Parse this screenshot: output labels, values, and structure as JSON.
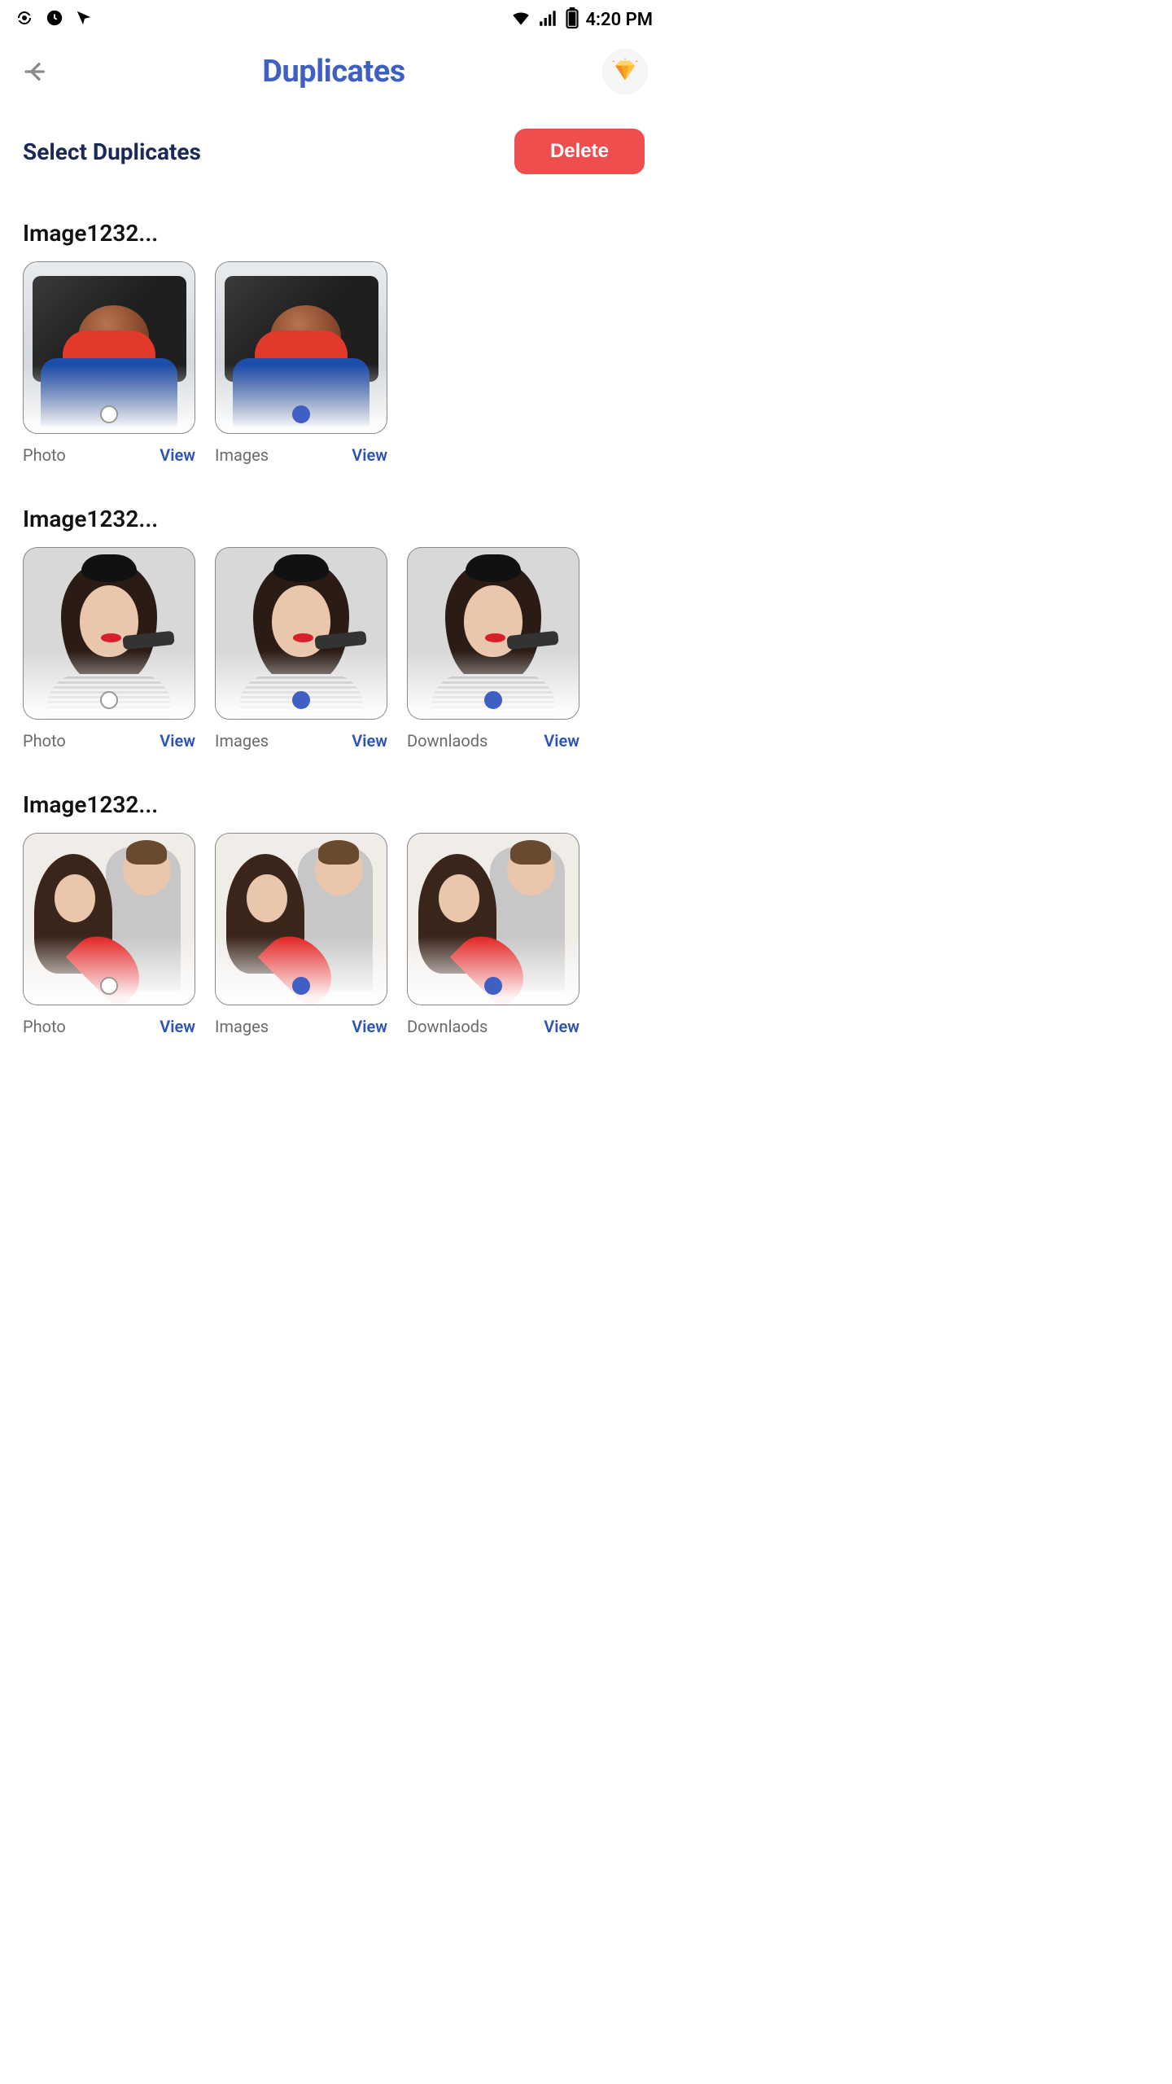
{
  "status": {
    "time": "4:20 PM"
  },
  "header": {
    "title": "Duplicates"
  },
  "subheader": {
    "title": "Select Duplicates",
    "delete_label": "Delete"
  },
  "view_label": "View",
  "groups": [
    {
      "title": "Image1232...",
      "image_kind": "car",
      "items": [
        {
          "folder": "Photo",
          "selected": false
        },
        {
          "folder": "Images",
          "selected": true
        }
      ]
    },
    {
      "title": "Image1232...",
      "image_kind": "woman",
      "items": [
        {
          "folder": "Photo",
          "selected": false
        },
        {
          "folder": "Images",
          "selected": true
        },
        {
          "folder": "Downlaods",
          "selected": true
        }
      ]
    },
    {
      "title": "Image1232...",
      "image_kind": "couple",
      "items": [
        {
          "folder": "Photo",
          "selected": false
        },
        {
          "folder": "Images",
          "selected": true
        },
        {
          "folder": "Downlaods",
          "selected": true
        }
      ]
    }
  ]
}
